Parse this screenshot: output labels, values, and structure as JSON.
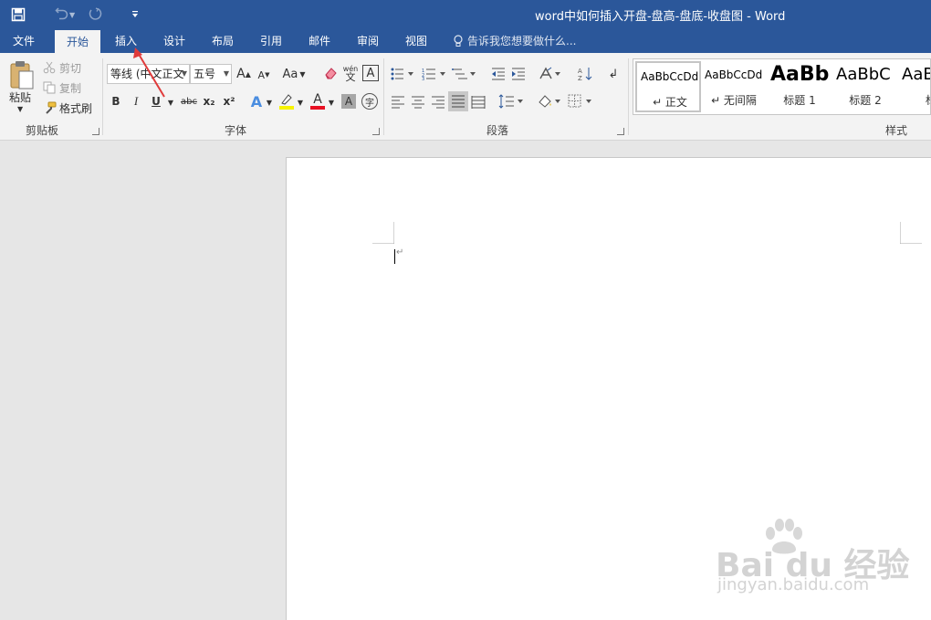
{
  "window": {
    "title": "word中如何插入开盘-盘高-盘底-收盘图 - Word"
  },
  "qat": {
    "save": "save-icon",
    "undo": "undo-icon",
    "redo": "redo-icon",
    "customize": "customize-icon"
  },
  "tabs": [
    {
      "label": "文件",
      "active": false
    },
    {
      "label": "开始",
      "active": true
    },
    {
      "label": "插入",
      "active": false
    },
    {
      "label": "设计",
      "active": false
    },
    {
      "label": "布局",
      "active": false
    },
    {
      "label": "引用",
      "active": false
    },
    {
      "label": "邮件",
      "active": false
    },
    {
      "label": "审阅",
      "active": false
    },
    {
      "label": "视图",
      "active": false
    }
  ],
  "tell_me": "告诉我您想要做什么...",
  "clipboard": {
    "paste": "粘贴",
    "cut": "剪切",
    "copy": "复制",
    "format_painter": "格式刷",
    "group": "剪贴板"
  },
  "font": {
    "font_name": "等线 (中文正文",
    "font_size": "五号",
    "group": "字体",
    "bold": "B",
    "italic": "I",
    "underline": "U",
    "strike": "abc",
    "subscript": "x₂",
    "superscript": "x²",
    "change_case": "Aa",
    "phonetic": "wén",
    "phonetic_char": "文",
    "border_char": "A",
    "font_color_char": "A",
    "shading_char": "A",
    "enclose_char": "字",
    "grow": "A",
    "shrink": "A"
  },
  "paragraph": {
    "group": "段落"
  },
  "styles": {
    "group": "样式",
    "items": [
      {
        "sample": "AaBbCcDd",
        "name": "↵ 正文"
      },
      {
        "sample": "AaBbCcDd",
        "name": "↵ 无间隔"
      },
      {
        "sample": "AaBb",
        "name": "标题 1"
      },
      {
        "sample": "AaBbC",
        "name": "标题 2"
      },
      {
        "sample": "AaB",
        "name": "标"
      }
    ]
  },
  "watermark": {
    "brand": "Bai du 经验",
    "url": "jingyan.baidu.com"
  },
  "colors": {
    "accent": "#2b579a",
    "ribbon_bg": "#f3f3f3",
    "doc_bg": "#e6e6e6",
    "annotation": "#e03b3b",
    "font_color_bar": "#e81123",
    "highlight_bar": "#f7f300"
  }
}
